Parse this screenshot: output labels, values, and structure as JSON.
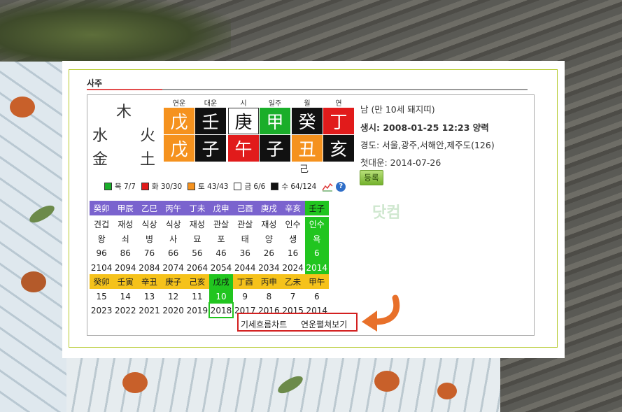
{
  "section_title": "사주",
  "elements": {
    "wood": "木",
    "water": "水",
    "fire": "火",
    "metal": "金",
    "earth": "土"
  },
  "pillar_labels": [
    "연운",
    "대운",
    "시",
    "일주",
    "월",
    "연"
  ],
  "pillars_top": [
    "戊",
    "壬",
    "庚",
    "甲",
    "癸",
    "丁"
  ],
  "pillars_bottom": [
    "戊",
    "子",
    "午",
    "子",
    "丑",
    "亥"
  ],
  "hidden_stem": "己",
  "legend": [
    {
      "label": "목 7/7",
      "color": "#1aae2a"
    },
    {
      "label": "화 30/30",
      "color": "#e11b1b"
    },
    {
      "label": "토 43/43",
      "color": "#f5921e"
    },
    {
      "label": "금 6/6",
      "color": "#ffffff"
    },
    {
      "label": "수 64/124",
      "color": "#111111"
    }
  ],
  "info": {
    "gender_age": "남 (만 10세 돼지띠)",
    "birth": "생시: 2008-01-25 12:23 양력",
    "longitude": "경도: 서울,광주,서해안,제주도(126)",
    "first_daeun": "첫대운: 2014-07-26",
    "register_button": "등록"
  },
  "daeun": {
    "header": [
      "癸卯",
      "甲辰",
      "乙巳",
      "丙午",
      "丁未",
      "戊申",
      "己酉",
      "庚戌",
      "辛亥",
      "壬子"
    ],
    "ten_gods": [
      "견겁",
      "재성",
      "식상",
      "식상",
      "재성",
      "관살",
      "관살",
      "재성",
      "인수",
      "인수"
    ],
    "stages": [
      "왕",
      "쇠",
      "병",
      "사",
      "묘",
      "포",
      "태",
      "양",
      "생",
      "욕"
    ],
    "ages": [
      "96",
      "86",
      "76",
      "66",
      "56",
      "46",
      "36",
      "26",
      "16",
      "6"
    ],
    "years": [
      "2104",
      "2094",
      "2084",
      "2074",
      "2064",
      "2054",
      "2044",
      "2034",
      "2024",
      "2014"
    ]
  },
  "yeonun": {
    "header": [
      "癸卯",
      "壬寅",
      "辛丑",
      "庚子",
      "己亥",
      "戊戌",
      "丁酉",
      "丙申",
      "乙未",
      "甲午"
    ],
    "ages": [
      "15",
      "14",
      "13",
      "12",
      "11",
      "10",
      "9",
      "8",
      "7",
      "6"
    ],
    "years": [
      "2023",
      "2022",
      "2021",
      "2020",
      "2019",
      "2018",
      "2017",
      "2016",
      "2015",
      "2014"
    ]
  },
  "links": {
    "chart": "기세흐름차트",
    "expand": "연운펼쳐보기"
  },
  "watermark": "닷컴"
}
